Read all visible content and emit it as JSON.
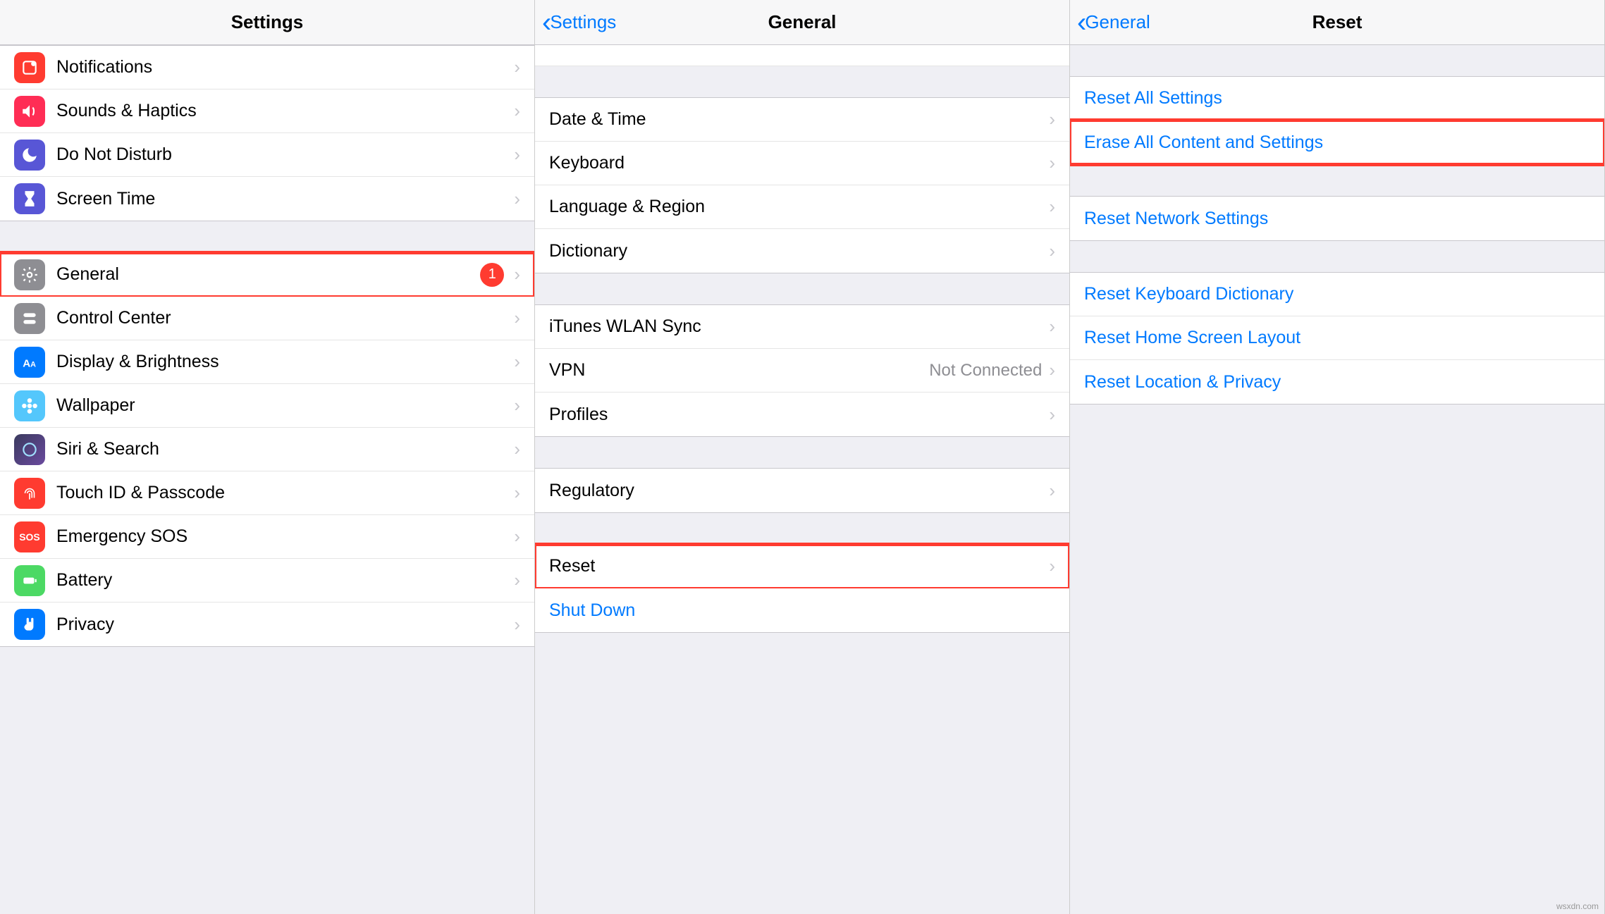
{
  "panel1": {
    "title": "Settings",
    "items": [
      {
        "label": "Notifications"
      },
      {
        "label": "Sounds & Haptics"
      },
      {
        "label": "Do Not Disturb"
      },
      {
        "label": "Screen Time"
      }
    ],
    "items2": [
      {
        "label": "General",
        "badge": "1"
      },
      {
        "label": "Control Center"
      },
      {
        "label": "Display & Brightness"
      },
      {
        "label": "Wallpaper"
      },
      {
        "label": "Siri & Search"
      },
      {
        "label": "Touch ID & Passcode"
      },
      {
        "label": "Emergency SOS"
      },
      {
        "label": "Battery"
      },
      {
        "label": "Privacy"
      }
    ]
  },
  "panel2": {
    "back": "Settings",
    "title": "General",
    "g1": [
      {
        "label": "Date & Time"
      },
      {
        "label": "Keyboard"
      },
      {
        "label": "Language & Region"
      },
      {
        "label": "Dictionary"
      }
    ],
    "g2": [
      {
        "label": "iTunes WLAN Sync"
      },
      {
        "label": "VPN",
        "detail": "Not Connected"
      },
      {
        "label": "Profiles"
      }
    ],
    "g3": [
      {
        "label": "Regulatory"
      }
    ],
    "g4": [
      {
        "label": "Reset"
      },
      {
        "label": "Shut Down",
        "link": true,
        "nochevron": true
      }
    ]
  },
  "panel3": {
    "back": "General",
    "title": "Reset",
    "g1": [
      {
        "label": "Reset All Settings"
      },
      {
        "label": "Erase All Content and Settings"
      }
    ],
    "g2": [
      {
        "label": "Reset Network Settings"
      }
    ],
    "g3": [
      {
        "label": "Reset Keyboard Dictionary"
      },
      {
        "label": "Reset Home Screen Layout"
      },
      {
        "label": "Reset Location & Privacy"
      }
    ]
  },
  "watermark": "wsxdn.com"
}
